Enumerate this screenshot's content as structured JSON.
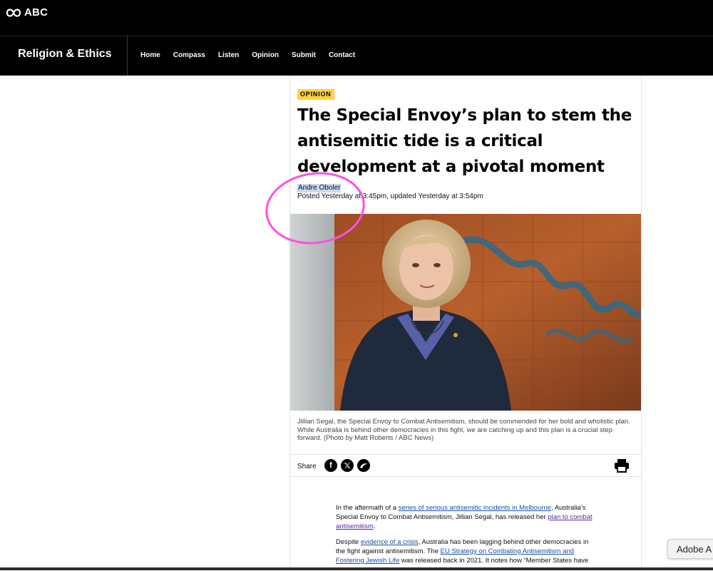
{
  "site": {
    "brand": "ABC"
  },
  "section": {
    "title": "Religion & Ethics",
    "nav": [
      "Home",
      "Compass",
      "Listen",
      "Opinion",
      "Submit",
      "Contact"
    ]
  },
  "article": {
    "badge": "OPINION",
    "headline": "The Special Envoy’s plan to stem the antisemitic tide is a critical development at a pivotal moment",
    "author": "Andre Oboler",
    "posted": "Posted Yesterday at 3:45pm, updated Yesterday at 3:54pm",
    "caption": "Jillian Segal, the Special Envoy to Combat Antisemitism, should be commended for her bold and wholistic plan. While Australia is behind other democracies in this fight, we are catching up and this plan is a crucial step forward. (Photo by Matt Roberts / ABC News)",
    "share": {
      "label": "Share",
      "icons": [
        "facebook-icon",
        "x-icon",
        "bluesky-icon"
      ]
    },
    "body": {
      "p1": {
        "t1": "In the aftermath of a ",
        "link1": "series of serious antisemitic incidents in Melbourne",
        "t2": ", Australia’s Special Envoy to Combat Antisemitism, Jillian Segal, has released her ",
        "link2": "plan to combat antisemitism",
        "t3": "."
      },
      "p2": {
        "t1": "Despite ",
        "link1": "evidence of a crisis",
        "t2": ", Australia has been lagging behind other democracies in the fight against antisemitism. The ",
        "link2": "EU Strategy on Combating Antisemitism and Fostering Jewish Life",
        "t3": " was released back in 2021. It notes how “Member States have"
      }
    }
  },
  "overlay": {
    "adobe_label": "Adobe A"
  },
  "colors": {
    "badge": "#ffd23f",
    "link": "#1b4fa0",
    "annotation": "#ff4fe0"
  }
}
